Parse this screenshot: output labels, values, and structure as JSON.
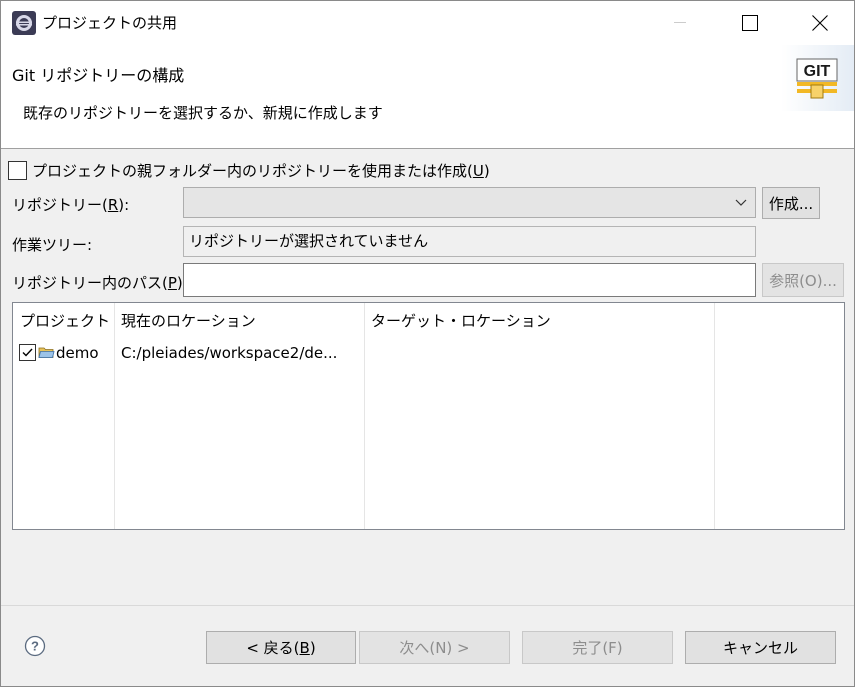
{
  "window": {
    "title": "プロジェクトの共用"
  },
  "banner": {
    "title": "Git リポジトリーの構成",
    "description": "既存のリポジトリーを選択するか、新規に作成します",
    "logo_text": "GIT"
  },
  "form": {
    "parent_checkbox_label": "プロジェクトの親フォルダー内のリポジトリーを使用または作成(",
    "parent_checkbox_key": "U",
    "parent_checkbox_suffix": ")",
    "parent_checkbox_checked": false,
    "repository_label": "リポジトリー(",
    "repository_key": "R",
    "repository_suffix": "):",
    "repository_value": "",
    "create_button": "作成...",
    "worktree_label": "作業ツリー:",
    "worktree_value": "リポジトリーが選択されていません",
    "path_label": "リポジトリー内のパス(",
    "path_key": "P",
    "path_suffix": "):",
    "path_value": "",
    "browse_button": "参照(O)..."
  },
  "table": {
    "columns": [
      "プロジェクト",
      "現在のロケーション",
      "ターゲット・ロケーション"
    ],
    "rows": [
      {
        "checked": true,
        "project": "demo",
        "current_location": "C:/pleiades/workspace2/de...",
        "target_location": ""
      }
    ]
  },
  "footer": {
    "back_button": "< 戻る(",
    "back_key": "B",
    "back_suffix": ")",
    "next_button": "次へ(N) >",
    "finish_button": "完了(F)",
    "cancel_button": "キャンセル"
  },
  "colors": {
    "window_bg": "#f0f0f0",
    "banner_bg": "#ffffff",
    "disabled_text": "#8d8d8d",
    "button_bg": "#e1e1e1"
  }
}
